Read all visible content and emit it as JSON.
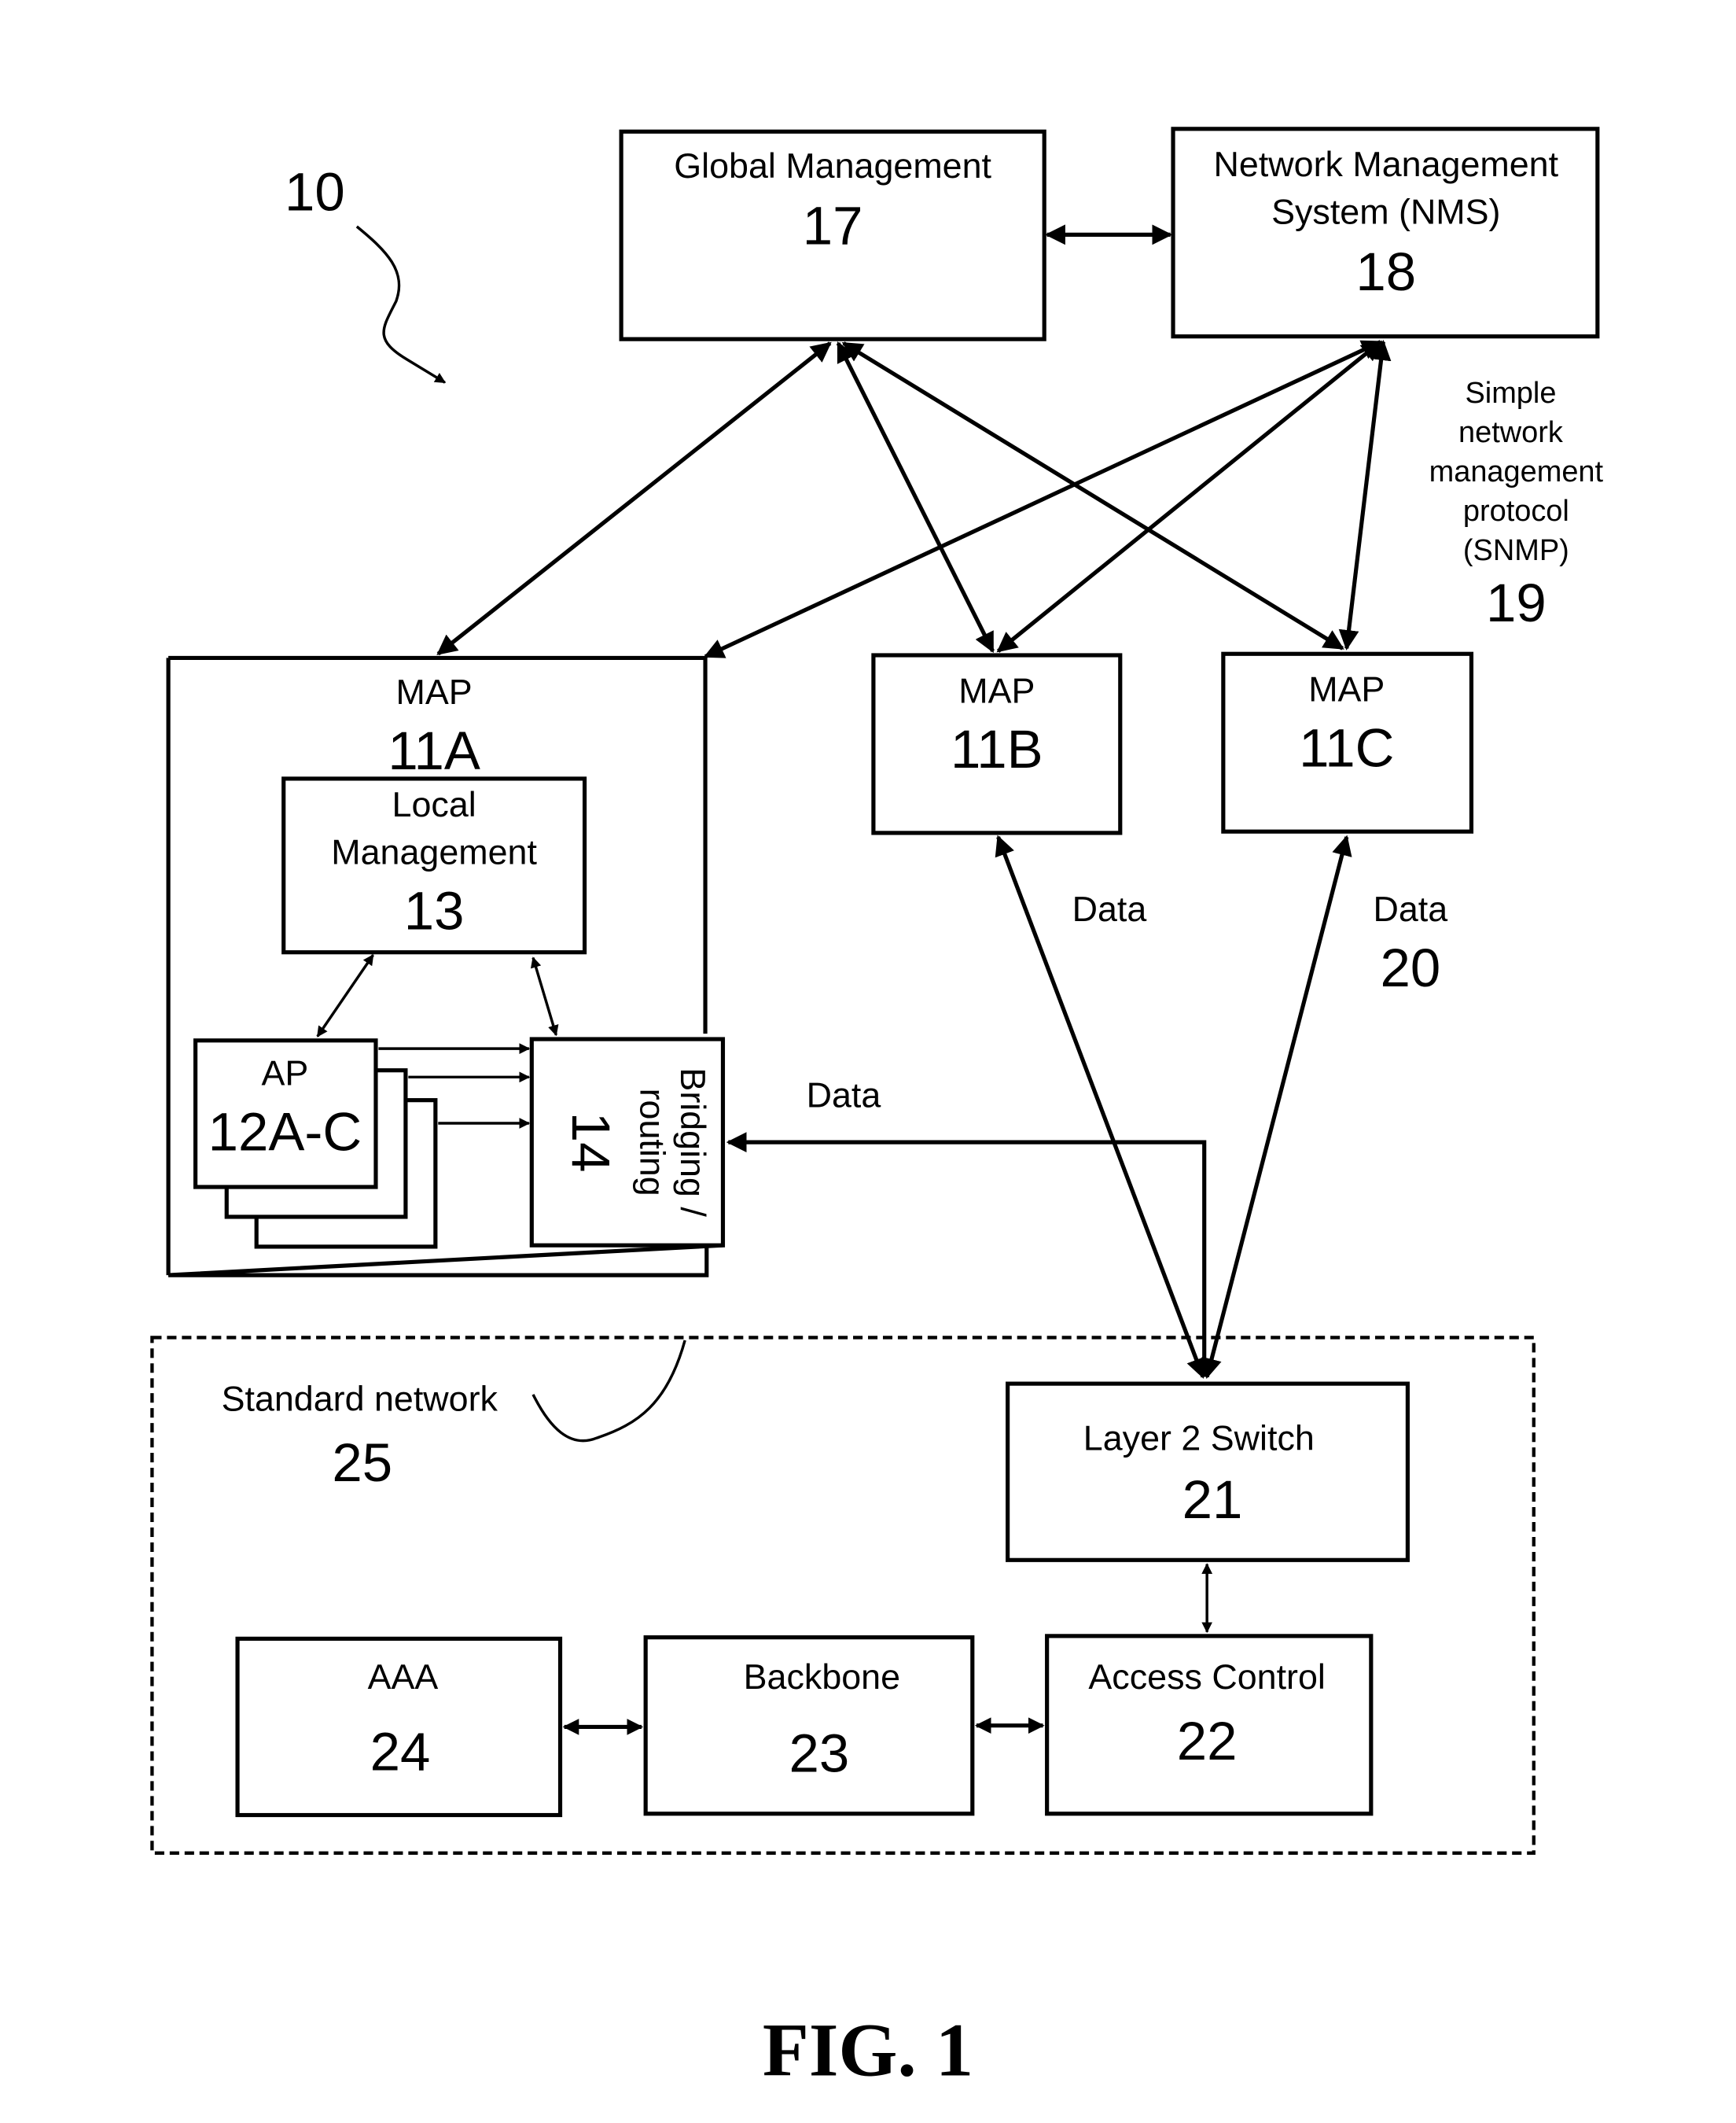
{
  "figure": {
    "ref_number": "10",
    "caption": "FIG. 1"
  },
  "nodes": {
    "global_management": {
      "label": "Global Management",
      "number": "17"
    },
    "nms": {
      "label_line1": "Network Management",
      "label_line2": "System (NMS)",
      "number": "18"
    },
    "snmp": {
      "lines": [
        "Simple",
        "network",
        "management",
        "protocol",
        "(SNMP)"
      ],
      "number": "19"
    },
    "map_11a": {
      "label": "MAP",
      "number": "11A"
    },
    "local_management": {
      "label_line1": "Local",
      "label_line2": "Management",
      "number": "13"
    },
    "ap": {
      "label": "AP",
      "number": "12A-C"
    },
    "bridging": {
      "label_line1": "Bridging /",
      "label_line2": "routing",
      "number": "14"
    },
    "map_11b": {
      "label": "MAP",
      "number": "11B"
    },
    "map_11c": {
      "label": "MAP",
      "number": "11C"
    },
    "data_labels": {
      "left": "Data",
      "middle": "Data",
      "right": "Data",
      "right_number": "20"
    },
    "standard_network": {
      "label": "Standard network",
      "number": "25"
    },
    "layer2_switch": {
      "label": "Layer 2 Switch",
      "number": "21"
    },
    "access_control": {
      "label": "Access Control",
      "number": "22"
    },
    "backbone": {
      "label": "Backbone",
      "number": "23"
    },
    "aaa": {
      "label": "AAA",
      "number": "24"
    }
  }
}
